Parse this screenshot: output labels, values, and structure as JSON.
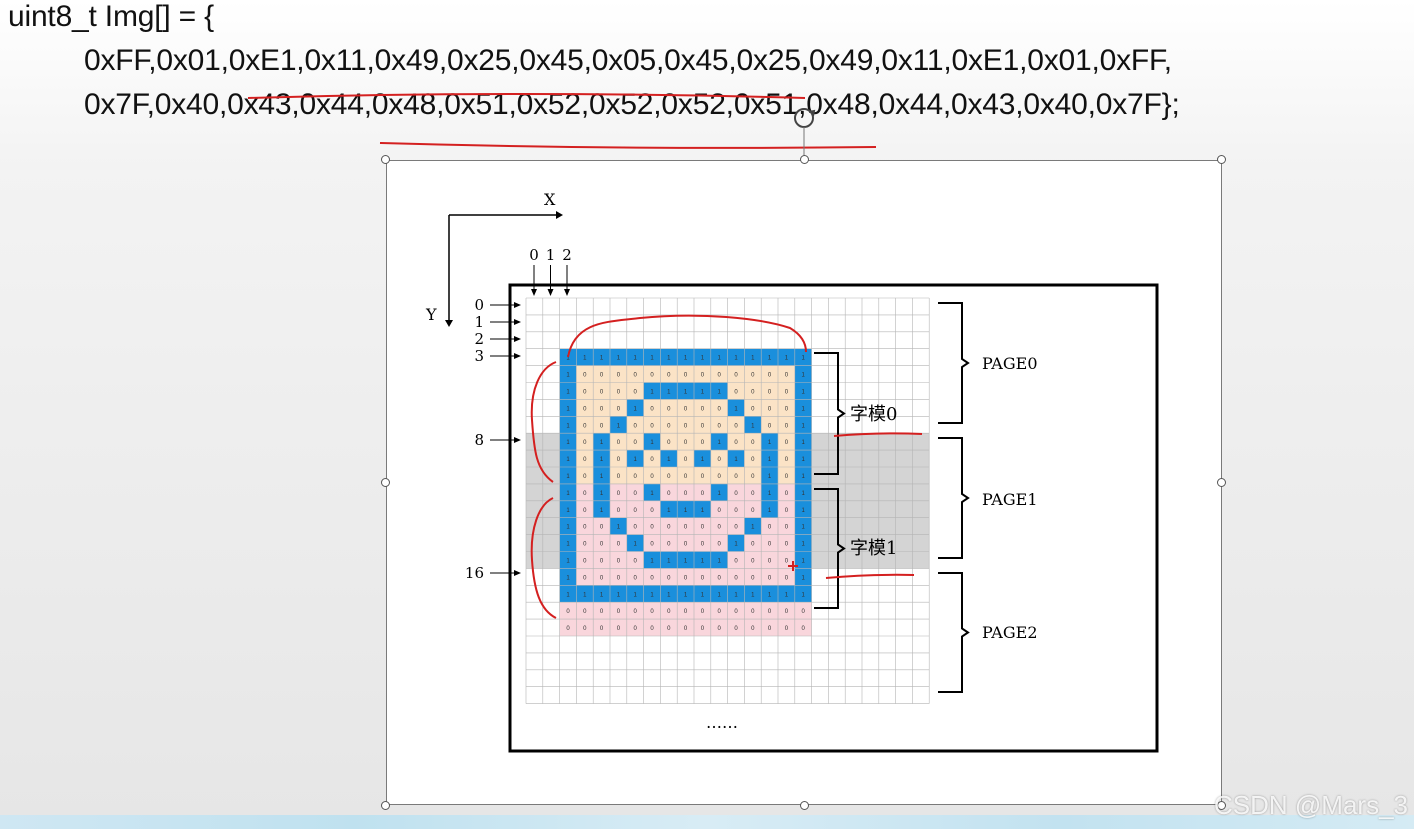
{
  "code": {
    "line1": "uint8_t Img[] = {",
    "line2": "0xFF,0x01,0xE1,0x11,0x49,0x25,0x45,0x05,0x45,0x25,0x49,0x11,0xE1,0x01,0xFF,",
    "line3": "0x7F,0x40,0x43,0x44,0x48,0x51,0x52,0x52,0x52,0x51,0x48,0x44,0x43,0x40,0x7F};"
  },
  "diagram": {
    "x_axis_label": "X",
    "y_axis_label": "Y",
    "col_labels": [
      "0",
      "1",
      "2"
    ],
    "row_labels": [
      "0",
      "1",
      "2",
      "3",
      "8",
      "16"
    ],
    "page_labels": [
      "PAGE0",
      "PAGE1",
      "PAGE2"
    ],
    "glyph_labels": [
      "字模0",
      "字模1"
    ],
    "ellipsis": "……",
    "font_bytes_page0": [
      255,
      1,
      225,
      17,
      73,
      37,
      69,
      5,
      69,
      37,
      73,
      17,
      225,
      1,
      255
    ],
    "font_bytes_page1": [
      127,
      64,
      67,
      68,
      72,
      81,
      82,
      82,
      82,
      81,
      72,
      68,
      67,
      64,
      127
    ],
    "colors": {
      "on_pixel": "#1a8fdc",
      "glyph0_bg": "#fbe3c6",
      "glyph1_bg": "#f9d6dc",
      "page_shade": "#d4d4d4",
      "annotation": "#d42020"
    }
  },
  "watermark": "CSDN @Mars_3"
}
